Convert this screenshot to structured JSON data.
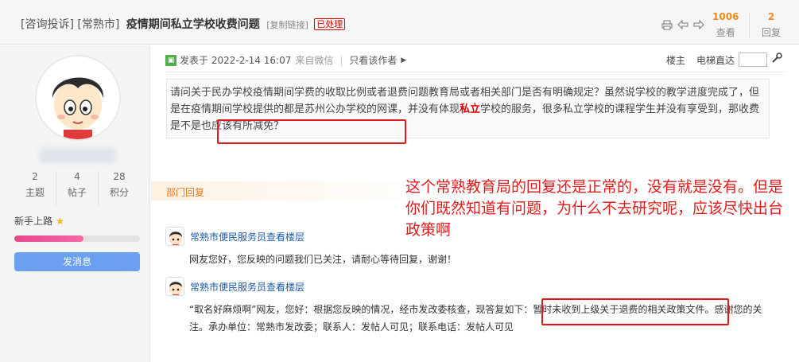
{
  "header": {
    "category": "[咨询投诉]",
    "city": "[常熟市]",
    "title": "疫情期间私立学校收费问题",
    "copy_link": "[复制链接]",
    "status_badge": "已处理",
    "views": "1006",
    "views_label": "查看",
    "replies": "2",
    "replies_label": "回复"
  },
  "profile": {
    "stats": [
      {
        "value": "2",
        "label": "主题"
      },
      {
        "value": "4",
        "label": "帖子"
      },
      {
        "value": "28",
        "label": "积分"
      }
    ],
    "rank": "新手上路",
    "progress_fraction": 0.55,
    "message_button": "发消息"
  },
  "post": {
    "posted_prefix": "发表于",
    "posted_time": "2022-2-14 16:07",
    "posted_from": "来自微信",
    "only_author": "只看该作者",
    "floor_label": "楼主",
    "elevator_label": "电梯直达",
    "body_part1": "请问关于民办学校疫情期间学费的收取比例或者退费问题教育局或者相关部门是否有明确规定？虽然说学校的教学进度完成了，但是在疫情期间学校提供的都是苏州公办学校的网课，并没有体现",
    "body_highlight": "私立",
    "body_part2": "学校的服务，很多私立学校的课程学生并没有享受到，那收费是不是也应该有所减免？"
  },
  "dept_reply_label": "部门回复",
  "annotation": "这个常熟教育局的回复还是正常的，没有就是没有。但是你们既然知道有问题，为什么不去研究呢，应该尽快出台政策啊",
  "replies": [
    {
      "name": "常熟市便民服务员查看楼层",
      "text": "网友您好，您反映的问题我们已关注，请耐心等待回复，谢谢！"
    },
    {
      "name": "常熟市便民服务员查看楼层",
      "text": "“取名好麻烦啊”网友，您好：根据您反映的情况，经市发改委核查，现答复如下：暂时未收到上级关于退费的相关政策文件。感谢您的关注。承办单位：常熟市发改委；联系人：发帖人可见；联系电话：发帖人可见"
    }
  ],
  "colors": {
    "accent_orange": "#e8791d",
    "annotation_red": "#e01c1c",
    "link_blue": "#1b5aa6",
    "button_blue": "#6aa0ef"
  }
}
